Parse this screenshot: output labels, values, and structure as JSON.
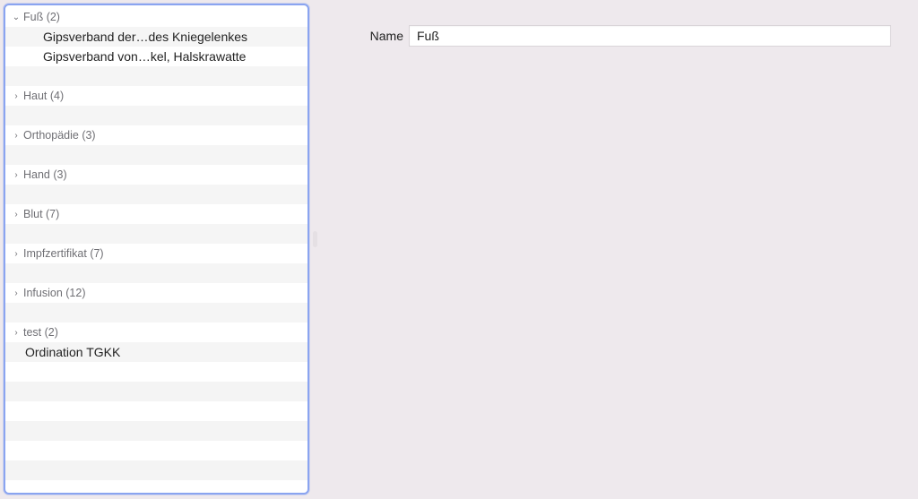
{
  "detail": {
    "name_label": "Name",
    "name_value": "Fuß"
  },
  "sidebar": {
    "groups": [
      {
        "id": "fuss",
        "label": "Fuß (2)",
        "expanded": true,
        "children": [
          "Gipsverband der…des Kniegelenkes",
          "Gipsverband von…kel, Halskrawatte"
        ]
      },
      {
        "id": "haut",
        "label": "Haut (4)",
        "expanded": false,
        "children": []
      },
      {
        "id": "ortho",
        "label": "Orthopädie (3)",
        "expanded": false,
        "children": []
      },
      {
        "id": "hand",
        "label": "Hand (3)",
        "expanded": false,
        "children": []
      },
      {
        "id": "blut",
        "label": "Blut (7)",
        "expanded": false,
        "children": []
      },
      {
        "id": "impf",
        "label": "Impfzertifikat (7)",
        "expanded": false,
        "children": []
      },
      {
        "id": "infusion",
        "label": "Infusion (12)",
        "expanded": false,
        "children": []
      },
      {
        "id": "test",
        "label": "test (2)",
        "expanded": false,
        "children": []
      }
    ],
    "flat_items": [
      "Ordination TGKK"
    ]
  },
  "glyphs": {
    "chev_down": "⌄",
    "chev_right": "›"
  }
}
